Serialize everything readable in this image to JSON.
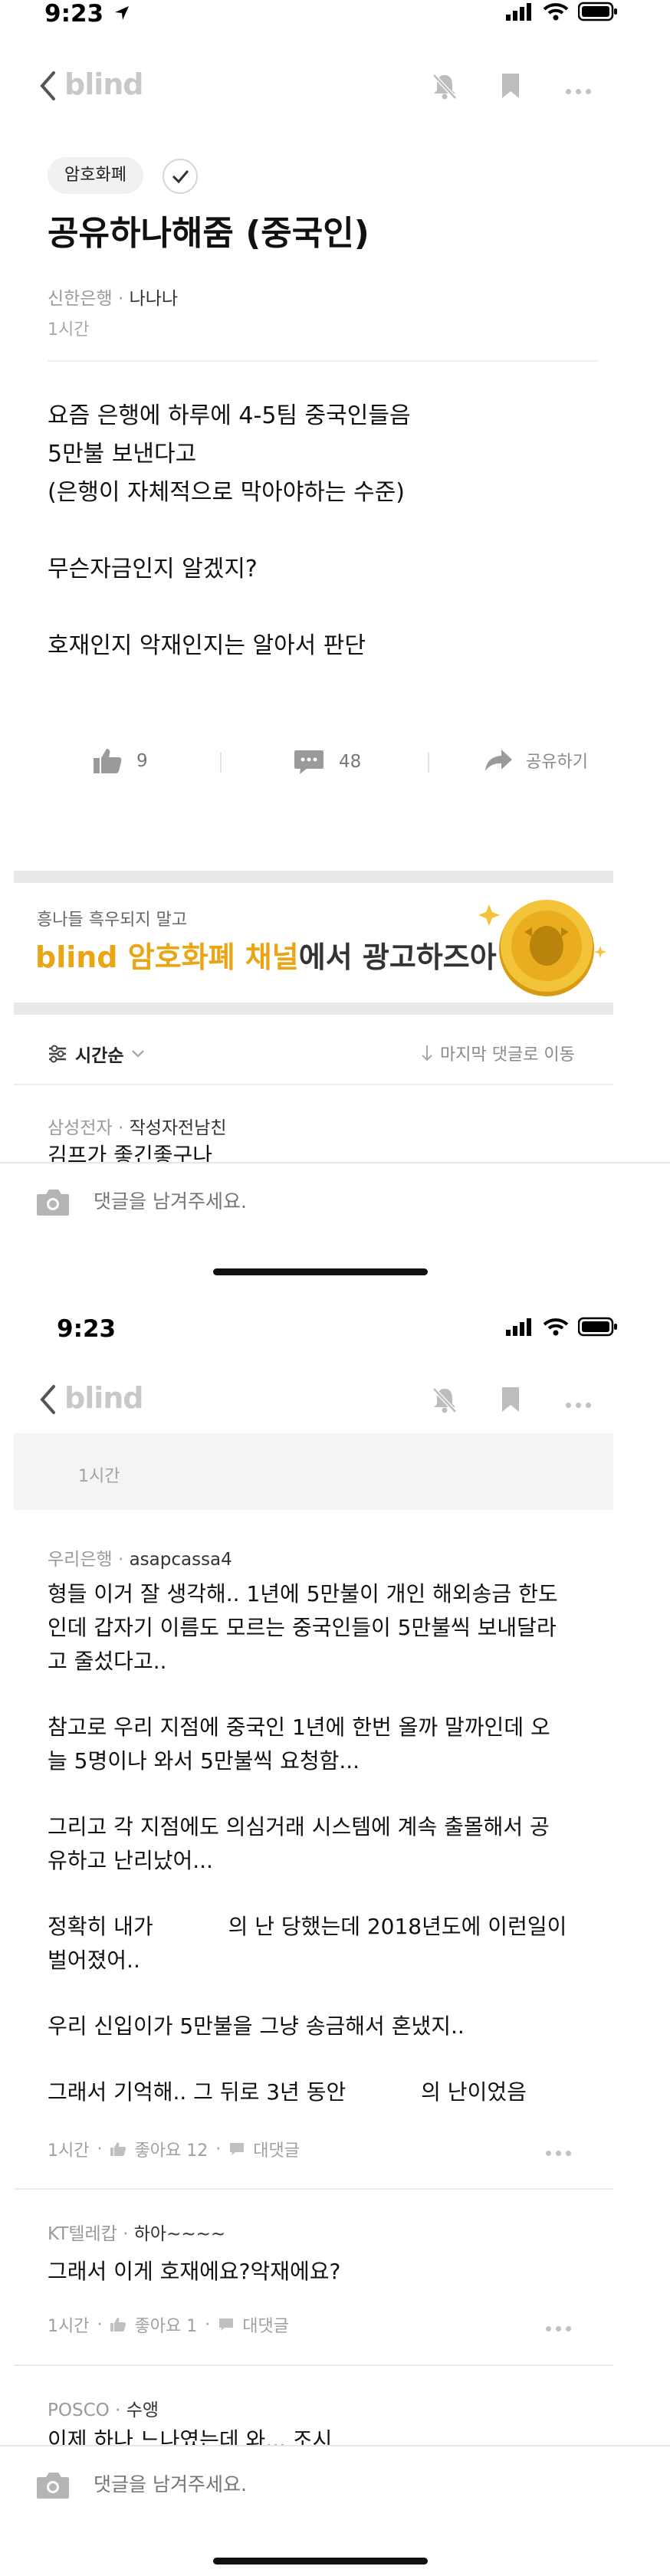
{
  "screen1": {
    "status_time": "9:23",
    "nav_logo": "blind",
    "category_chip": "암호화폐",
    "post_title": "공유하나해줌 (중국인)",
    "author_company": "신한은행",
    "author_sep": "·",
    "author_nick": "나나나",
    "post_time": "1시간",
    "body_lines": [
      "요즘 은행에 하루에 4-5팀 중국인들음",
      "5만불 보낸다고",
      "(은행이 자체적으로 막아야하는 수준)",
      "",
      "무슨자금인지 알겠지?",
      "",
      "호재인지 악재인지는 알아서 판단"
    ],
    "like_count": "9",
    "comment_count": "48",
    "share_label": "공유하기",
    "banner_small": "흥나들 흑우되지 말고",
    "banner_big_accent": "blind 암호화폐 채널",
    "banner_big_rest": "에서 광고하즈아",
    "sort_label": "시간순",
    "jump_label": "마지막 댓글로 이동",
    "peek_company": "삼성전자",
    "peek_nick": "작성자전남친",
    "peek_text": "김프가 좋긴좋구나",
    "comment_placeholder": "댓글을 남겨주세요."
  },
  "screen2": {
    "status_time": "9:23",
    "nav_logo": "blind",
    "prev_time": "1시간",
    "comments": [
      {
        "company": "우리은행",
        "nick": "asapcassa4",
        "lines": [
          "형들 이거 잘 생각해.. 1년에 5만불이 개인 해외송금 한도",
          "인데 갑자기 이름도 모르는 중국인들이 5만불씩 보내달라",
          "고 줄섰다고..",
          "",
          "참고로 우리 지점에 중국인 1년에 한번 올까 말까인데 오",
          "늘 5명이나 와서 5만불씩 요청함...",
          "",
          "그리고 각 지점에도 의심거래 시스템에 계속 출몰해서 공",
          "유하고 난리났어...",
          "",
          "정확히 내가           의 난 당했는데 2018년도에 이런일이",
          "벌어졌어..",
          "",
          "우리 신입이가 5만불을 그냥 송금해서 혼냈지..",
          "",
          "그래서 기억해.. 그 뒤로 3년 동안           의 난이었음"
        ],
        "time": "1시간",
        "like_label": "좋아요 12",
        "reply_label": "대댓글"
      },
      {
        "company": "KT텔레캅",
        "nick": "하아~~~~",
        "lines": [
          "그래서 이게 호재에요?악재에요?"
        ],
        "time": "1시간",
        "like_label": "좋아요 1",
        "reply_label": "대댓글"
      }
    ],
    "peek_company": "POSCO",
    "peek_nick": "수앵",
    "peek_text": "이제 하나 느나였는데 와... 조시",
    "comment_placeholder": "댓글을 남겨주세요."
  },
  "colors": {
    "accent_gold": "#e9a514",
    "logo_gray": "#c8c8c8",
    "divider": "#ececec"
  },
  "icons": [
    "back-chevron-icon",
    "bell-off-icon",
    "bookmark-icon",
    "more-icon",
    "check-icon",
    "thumbs-up-icon",
    "comment-icon",
    "share-arrow-icon",
    "sort-icon",
    "chevron-down-icon",
    "arrow-down-icon",
    "camera-icon",
    "coin-icon",
    "signal-icon",
    "wifi-icon",
    "battery-icon",
    "location-arrow-icon"
  ]
}
